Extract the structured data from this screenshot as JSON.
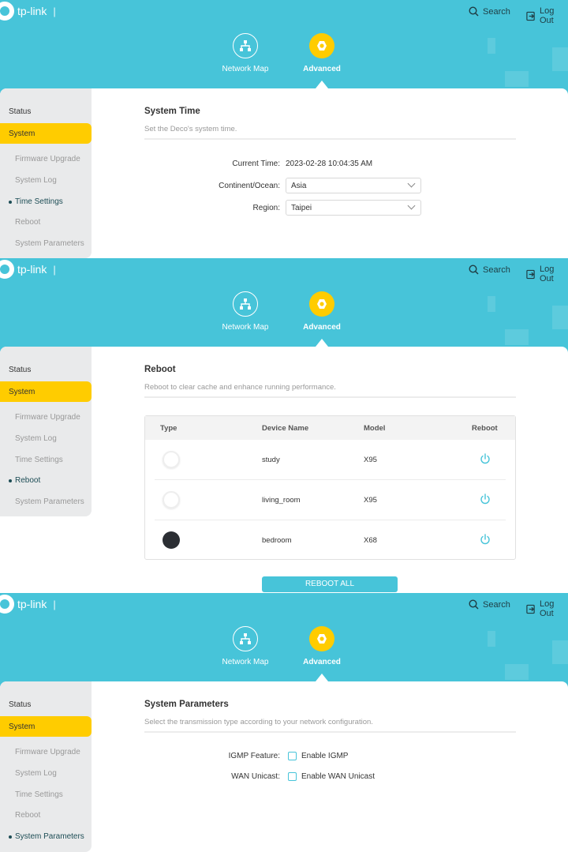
{
  "header": {
    "brand": "tp-link",
    "search": "Search",
    "logout": "Log Out"
  },
  "nav": {
    "network_map": "Network Map",
    "advanced": "Advanced"
  },
  "sidebar": {
    "status": "Status",
    "system": "System",
    "items": [
      "Firmware Upgrade",
      "System Log",
      "Time Settings",
      "Reboot",
      "System Parameters"
    ]
  },
  "colors": {
    "brand": "#47c4d9",
    "accent": "#ffcc00"
  },
  "time": {
    "title": "System Time",
    "subtitle": "Set the Deco's system time.",
    "current_label": "Current Time:",
    "current_value": "2023-02-28 10:04:35 AM",
    "continent_label": "Continent/Ocean:",
    "continent_value": "Asia",
    "region_label": "Region:",
    "region_value": "Taipei"
  },
  "reboot": {
    "title": "Reboot",
    "subtitle": "Reboot to clear cache and enhance running performance.",
    "columns": [
      "Type",
      "Device Name",
      "Model",
      "Reboot"
    ],
    "rows": [
      {
        "type": "white",
        "name": "study",
        "model": "X95"
      },
      {
        "type": "white",
        "name": "living_room",
        "model": "X95"
      },
      {
        "type": "black",
        "name": "bedroom",
        "model": "X68"
      }
    ],
    "button": "REBOOT ALL"
  },
  "params": {
    "title": "System Parameters",
    "subtitle": "Select the transmission type according to your network configuration.",
    "igmp_label": "IGMP Feature:",
    "igmp_option": "Enable IGMP",
    "igmp_checked": false,
    "wan_label": "WAN Unicast:",
    "wan_option": "Enable WAN Unicast",
    "wan_checked": false
  }
}
